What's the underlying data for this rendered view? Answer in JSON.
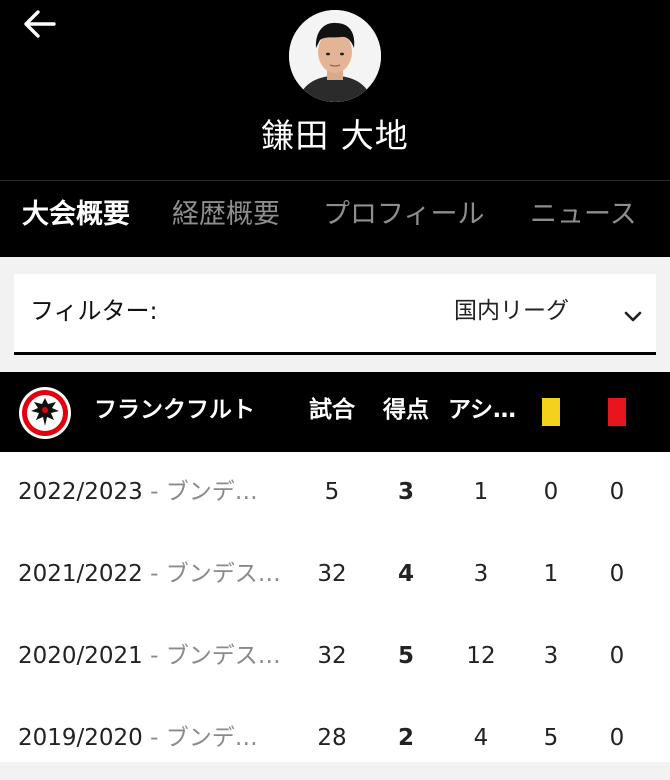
{
  "header": {
    "back_icon": "arrow-left-icon",
    "player_name": "鎌田 大地",
    "avatar": "player-photo"
  },
  "tabs": [
    {
      "label": "大会概要",
      "active": true
    },
    {
      "label": "経歴概要",
      "active": false
    },
    {
      "label": "プロフィール",
      "active": false
    },
    {
      "label": "ニュース",
      "active": false
    }
  ],
  "filter": {
    "label": "フィルター:",
    "value": "国内リーグ",
    "icon": "chevron-down-icon"
  },
  "table": {
    "team_name": "フランクフルト",
    "team_crest": "eagle-crest-icon",
    "columns": {
      "matches": "試合",
      "goals": "得点",
      "assists": "アシ…"
    },
    "yellow_card_color": "#f4d21c",
    "red_card_color": "#e8141e",
    "rows": [
      {
        "season": "2022/2023",
        "competition": "ブンデ…",
        "matches": "5",
        "goals": "3",
        "assists": "1",
        "yellow": "0",
        "red": "0"
      },
      {
        "season": "2021/2022",
        "competition": "ブンデス…",
        "matches": "32",
        "goals": "4",
        "assists": "3",
        "yellow": "1",
        "red": "0"
      },
      {
        "season": "2020/2021",
        "competition": "ブンデス…",
        "matches": "32",
        "goals": "5",
        "assists": "12",
        "yellow": "3",
        "red": "0"
      },
      {
        "season": "2019/2020",
        "competition": "ブンデ…",
        "matches": "28",
        "goals": "2",
        "assists": "4",
        "yellow": "5",
        "red": "0"
      }
    ]
  }
}
